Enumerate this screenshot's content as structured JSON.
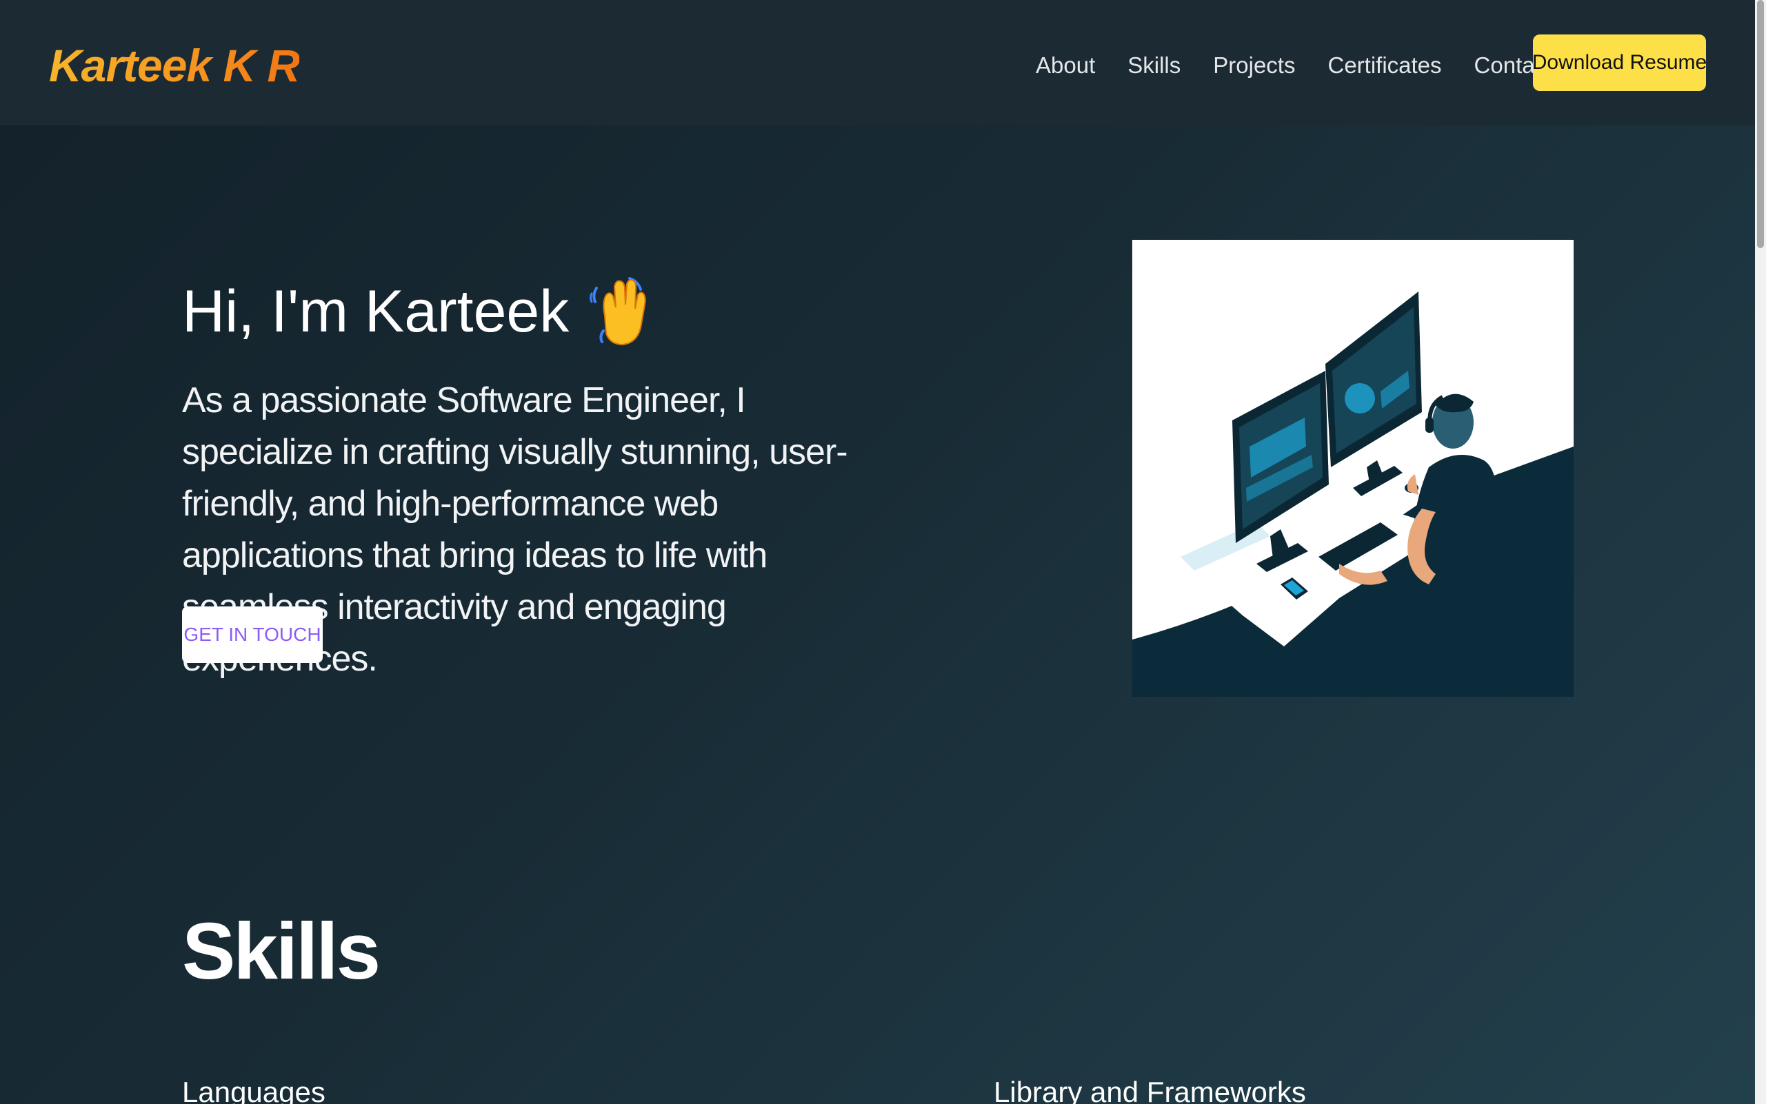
{
  "header": {
    "brand": "Karteek K R",
    "nav": [
      "About",
      "Skills",
      "Projects",
      "Certificates",
      "Contact"
    ],
    "download_label": "Download Resume",
    "download_color": "#fde047"
  },
  "hero": {
    "title": "Hi, I'm Karteek",
    "wave_icon": "waving-hand-icon",
    "description": "As a passionate Software Engineer, I specialize in crafting visually stunning, user-friendly, and high-performance web applications that bring ideas to life with seamless interactivity and engaging experiences.",
    "cta_label": "GET IN TOUCH",
    "cta_color": "#8b5cf6",
    "illustration": "developer-at-desk-illustration"
  },
  "skills": {
    "title": "Skills",
    "categories": [
      "Languages",
      "Library and Frameworks"
    ]
  }
}
